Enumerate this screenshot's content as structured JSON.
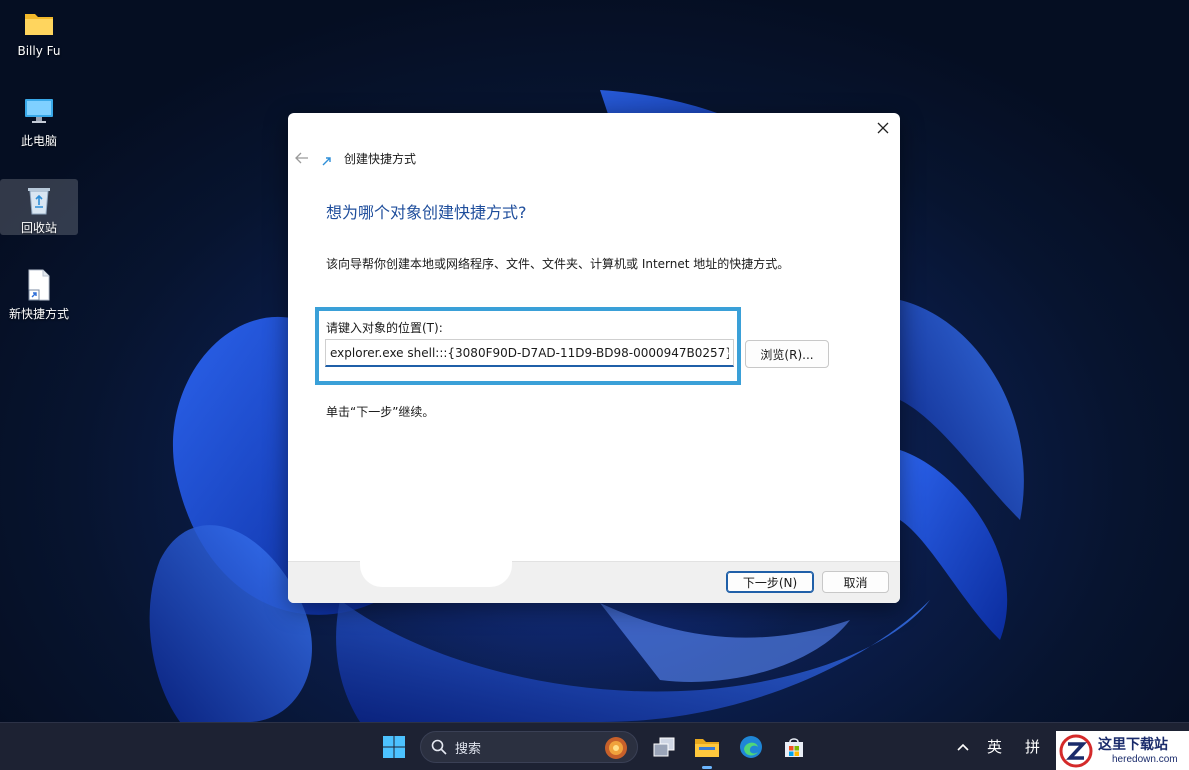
{
  "desktop": {
    "icons": [
      {
        "label": "Billy Fu",
        "icon": "folder-icon"
      },
      {
        "label": "此电脑",
        "icon": "computer-icon"
      },
      {
        "label": "回收站",
        "icon": "recycle-bin-icon"
      },
      {
        "label": "新快捷方式",
        "icon": "shortcut-file-icon"
      }
    ]
  },
  "dialog": {
    "title": "创建快捷方式",
    "heading": "想为哪个对象创建快捷方式?",
    "description": "该向导帮你创建本地或网络程序、文件、文件夹、计算机或 Internet 地址的快捷方式。",
    "location_label": "请键入对象的位置(T):",
    "location_value": "explorer.exe shell:::{3080F90D-D7AD-11D9-BD98-0000947B0257}",
    "browse_label": "浏览(R)...",
    "hint": "单击“下一步”继续。",
    "next_label": "下一步(N)",
    "cancel_label": "取消"
  },
  "taskbar": {
    "search_placeholder": "搜索",
    "tray": {
      "ime_language": "英",
      "ime_mode": "拼"
    },
    "accent": "#6cb6ff"
  },
  "watermark": {
    "name": "这里下载站",
    "site": "heredown.com"
  },
  "colors": {
    "highlight_border": "#3aa0d8",
    "heading": "#1f4e9c",
    "primary_button_border": "#1f5fa8"
  }
}
